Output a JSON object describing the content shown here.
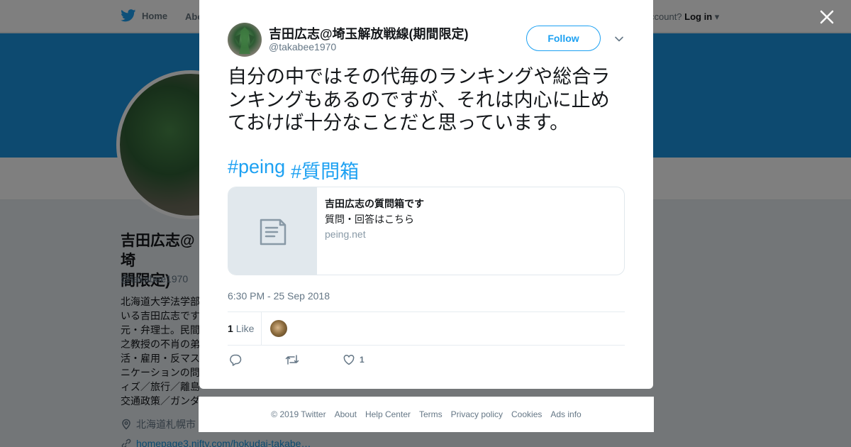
{
  "background": {
    "nav": {
      "home": "Home",
      "about": "Abo",
      "account_prefix": "ccount?",
      "login": "Log in"
    },
    "profile": {
      "name": "吉田広志@埼\n間限定)",
      "handle": "@takabee1970",
      "bio": "北海道大学法学部\nいる吉田広志です\n元・弁理士。民間\n之教授の不肖の弟\n活・雇用・反マス\nニケーションの問\nィズ／旅行／離島\n交通政策／ガンダ",
      "location": "北海道札幌市",
      "website": "homepage3.nifty.com/hokudai-takabe…"
    }
  },
  "tweet": {
    "author_name": "吉田広志@埼玉解放戦線(期間限定)",
    "author_handle": "@takabee1970",
    "follow_label": "Follow",
    "text": "自分の中ではその代毎のランキングや総合ランキングもあるのですが、それは内心に止めておけば十分なことだと思っています。",
    "hashtags": [
      "#peing",
      "#質問箱"
    ],
    "card": {
      "title": "吉田広志の質問箱です",
      "description": "質問・回答はこちら",
      "domain": "peing.net"
    },
    "timestamp": "6:30 PM - 25 Sep 2018",
    "likes_count": "1",
    "likes_label": "Like",
    "action_like_count": "1"
  },
  "footer": {
    "links": [
      "© 2019 Twitter",
      "About",
      "Help Center",
      "Terms",
      "Privacy policy",
      "Cookies",
      "Ads info"
    ]
  },
  "colors": {
    "brand_blue": "#1da1f2",
    "banner": "#1b95e0",
    "text_dark": "#14171a",
    "text_muted": "#657786"
  },
  "icons": {
    "nav_home": "twitter-bird-icon",
    "close": "close-icon",
    "caret": "chevron-down-icon",
    "card_thumb": "document-icon",
    "reply": "reply-icon",
    "retweet": "retweet-icon",
    "like": "heart-icon",
    "location": "location-pin-icon",
    "link": "link-icon"
  }
}
